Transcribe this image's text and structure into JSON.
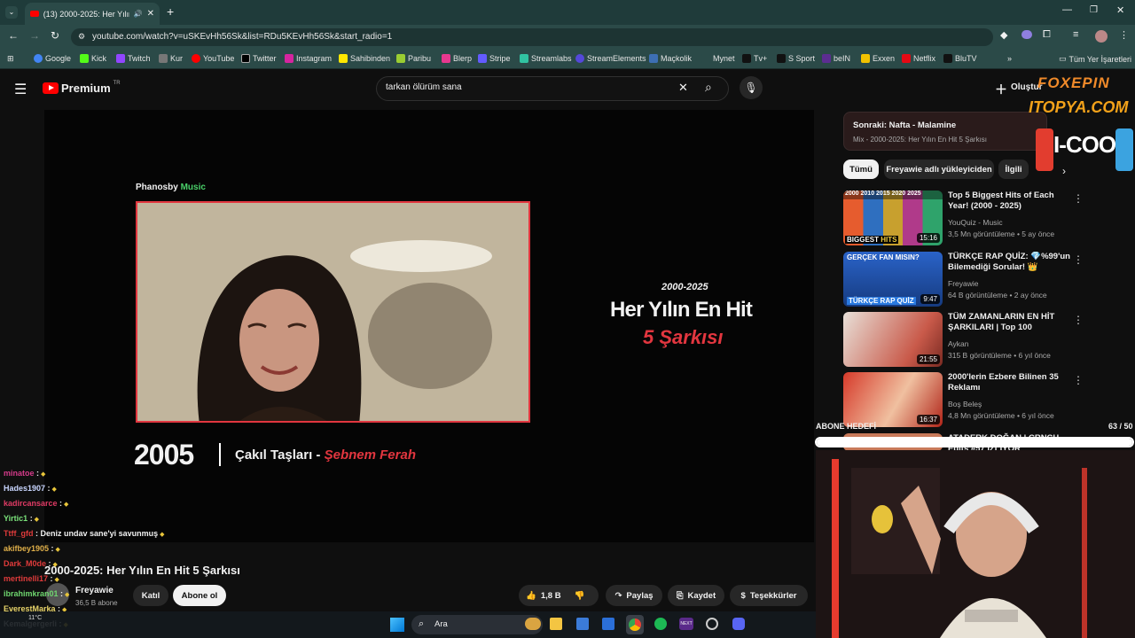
{
  "browser": {
    "tab_title": "(13) 2000-2025: Her Yılın En",
    "url": "youtube.com/watch?v=uSKEvHh56Sk&list=RDu5KEvHh56Sk&start_radio=1",
    "bookmarks": [
      "Google",
      "Kick",
      "Twitch",
      "Kur",
      "YouTube",
      "Twitter",
      "Instagram",
      "Sahibinden",
      "Paribu",
      "Blerp",
      "Stripe",
      "Streamlabs",
      "StreamElements",
      "Maçkolik",
      "Mynet",
      "Tv+",
      "S Sport",
      "beIN",
      "Exxen",
      "Netflix",
      "BluTV"
    ],
    "all_bookmarks": "Tüm Yer İşaretleri"
  },
  "youtube": {
    "logo": "Premium",
    "logo_sup": "TR",
    "search_value": "tarkan ölürüm sana",
    "create_label": "Oluştur"
  },
  "video": {
    "brand_a": "Phanosby",
    "brand_b": "Music",
    "years": "2000-2025",
    "headline": "Her Yılın En Hit",
    "headline_red": "5 Şarkısı",
    "year": "2005",
    "song": "Çakıl Taşları -",
    "artist": "Şebnem Ferah",
    "title": "2000-2025: Her Yılın En Hit 5 Şarkısı",
    "channel": "Freyawie",
    "subs": "36,5 B abone",
    "join": "Katıl",
    "subscribe": "Abone ol",
    "likes": "1,8 B",
    "share": "Paylaş",
    "save": "Kaydet",
    "thanks": "Teşekkürler"
  },
  "sidebar": {
    "next_label": "Sonraki: Nafta - Malamine",
    "next_sub": "Mix - 2000-2025: Her Yılın En Hit 5 Şarkısı",
    "chips": [
      "Tümü",
      "Freyawie adlı yükleyiciden",
      "İlgili"
    ],
    "items": [
      {
        "title": "Top 5 Biggest Hits of Each Year! (2000 - 2025)",
        "channel": "YouQuiz - Music",
        "meta": "3,5 Mn görüntüleme • 5 ay önce",
        "duration": "15:16"
      },
      {
        "title": "TÜRKÇE RAP QUİZ: 💎%99'un Bilemediği Sorular! 👑",
        "channel": "Freyawie",
        "meta": "64 B görüntüleme • 2 ay önce",
        "duration": "9:47"
      },
      {
        "title": "TÜM ZAMANLARIN EN HİT ŞARKILARI | Top 100",
        "channel": "Aykan",
        "meta": "315 B görüntüleme • 6 yıl önce",
        "duration": "21:55"
      },
      {
        "title": "2000'lerin Ezbere Bilinen 35 Reklamı",
        "channel": "Boş Beleş",
        "meta": "4,8 Mn görüntüleme • 6 yıl önce",
        "duration": "16:37"
      },
      {
        "title": "ATADERK DOĞAN | CRNCH Edits #57 İZLİYOR",
        "channel": "",
        "meta": "",
        "duration": ""
      }
    ]
  },
  "overlay": {
    "goal_label": "ABONE HEDEFİ",
    "goal_value": "63 / 50",
    "goal_progress": 1.0,
    "sponsor_1": "FOXEPIN",
    "sponsor_2": "ITOPYA.COM",
    "sponsor_3": "I-COOL"
  },
  "chat": [
    {
      "user": "minatoe",
      "msg": ":",
      "color": "#d43b8a"
    },
    {
      "user": "Hades1907",
      "msg": ":",
      "color": "#c9d6ff"
    },
    {
      "user": "kadircansarce",
      "msg": ":",
      "color": "#e03b65"
    },
    {
      "user": "Yirtic1",
      "msg": ":",
      "color": "#7be37b"
    },
    {
      "user": "Ttff_gfd",
      "msg": ": Deniz undav sane'yi savunmuş",
      "color": "#e03b3b"
    },
    {
      "user": "akifbey1905",
      "msg": ":",
      "color": "#e0b04a"
    },
    {
      "user": "Dark_M0de",
      "msg": ":",
      "color": "#e03b3b"
    },
    {
      "user": "mertinelli17",
      "msg": ":",
      "color": "#e03b3b"
    },
    {
      "user": "ibrahimkran01",
      "msg": ":",
      "color": "#6fd66f"
    },
    {
      "user": "EverestMarka",
      "msg": ":",
      "color": "#e8d46a"
    },
    {
      "user": "Kemalgergerli",
      "msg": ":",
      "color": "#e0e0e0"
    }
  ],
  "taskbar": {
    "search": "Ara",
    "temp": "11°C"
  },
  "colors": {
    "accent_red": "#e2363f",
    "chrome_teal": "#2b4a48"
  }
}
